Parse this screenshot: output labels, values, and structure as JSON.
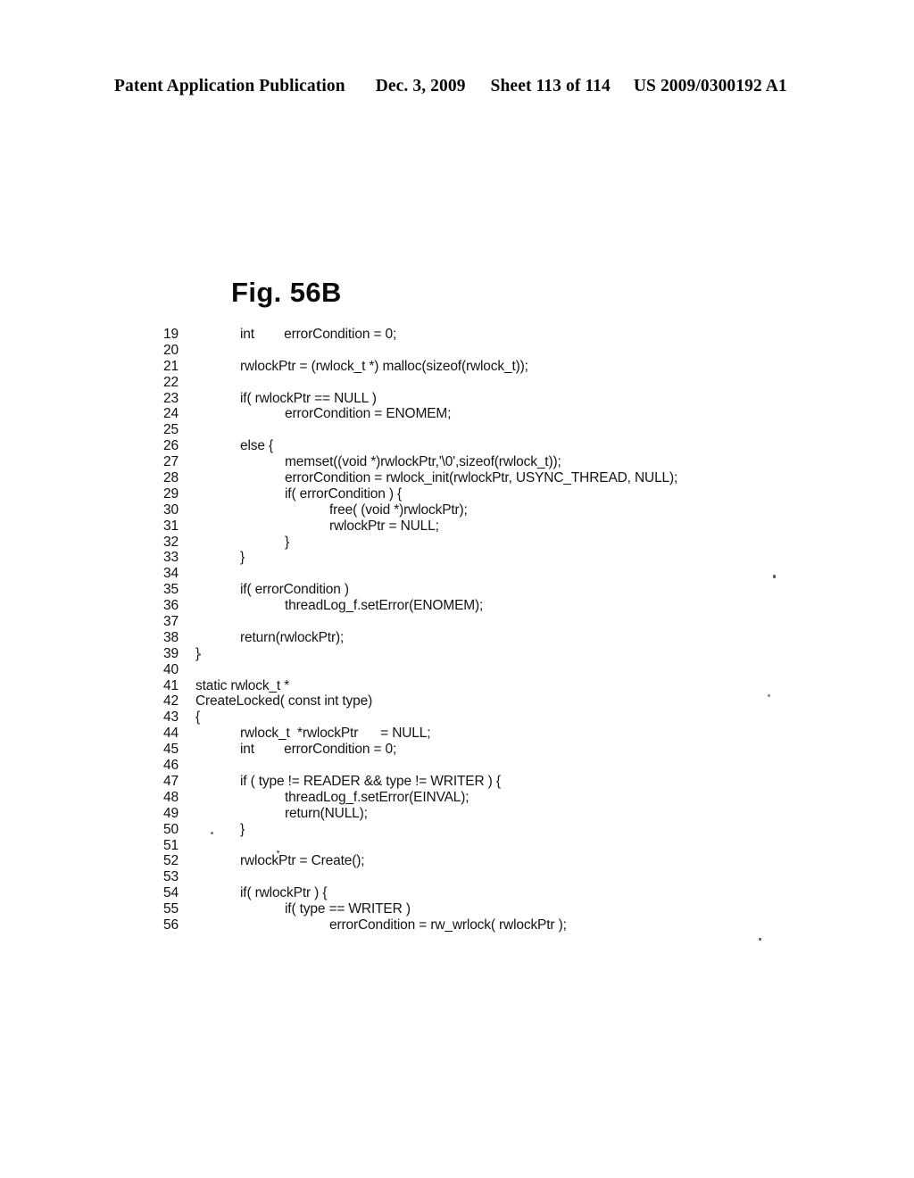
{
  "header": {
    "publication": "Patent Application Publication",
    "date": "Dec. 3, 2009",
    "sheet": "Sheet 113 of 114",
    "doc_number": "US 2009/0300192 A1"
  },
  "figure": {
    "label": "Fig. 56B"
  },
  "listing": {
    "lines": [
      {
        "no": "19",
        "indent": 1,
        "code": "int        errorCondition = 0;"
      },
      {
        "no": "20",
        "indent": 0,
        "code": ""
      },
      {
        "no": "21",
        "indent": 1,
        "code": "rwlockPtr = (rwlock_t *) malloc(sizeof(rwlock_t));"
      },
      {
        "no": "22",
        "indent": 0,
        "code": ""
      },
      {
        "no": "23",
        "indent": 1,
        "code": "if( rwlockPtr == NULL )"
      },
      {
        "no": "24",
        "indent": 2,
        "code": "errorCondition = ENOMEM;"
      },
      {
        "no": "25",
        "indent": 0,
        "code": ""
      },
      {
        "no": "26",
        "indent": 1,
        "code": "else {"
      },
      {
        "no": "27",
        "indent": 2,
        "code": "memset((void *)rwlockPtr,'\\0',sizeof(rwlock_t));"
      },
      {
        "no": "28",
        "indent": 2,
        "code": "errorCondition = rwlock_init(rwlockPtr, USYNC_THREAD, NULL);"
      },
      {
        "no": "29",
        "indent": 2,
        "code": "if( errorCondition ) {"
      },
      {
        "no": "30",
        "indent": 3,
        "code": "free( (void *)rwlockPtr);"
      },
      {
        "no": "31",
        "indent": 3,
        "code": "rwlockPtr = NULL;"
      },
      {
        "no": "32",
        "indent": 2,
        "code": "}"
      },
      {
        "no": "33",
        "indent": 1,
        "code": "}"
      },
      {
        "no": "34",
        "indent": 0,
        "code": ""
      },
      {
        "no": "35",
        "indent": 1,
        "code": "if( errorCondition )"
      },
      {
        "no": "36",
        "indent": 2,
        "code": "threadLog_f.setError(ENOMEM);"
      },
      {
        "no": "37",
        "indent": 0,
        "code": ""
      },
      {
        "no": "38",
        "indent": 1,
        "code": "return(rwlockPtr);"
      },
      {
        "no": "39",
        "indent": 0,
        "code": "}"
      },
      {
        "no": "40",
        "indent": 0,
        "code": ""
      },
      {
        "no": "41",
        "indent": 0,
        "code": "static rwlock_t *"
      },
      {
        "no": "42",
        "indent": 0,
        "code": "CreateLocked( const int type)"
      },
      {
        "no": "43",
        "indent": 0,
        "code": "{"
      },
      {
        "no": "44",
        "indent": 1,
        "code": "rwlock_t  *rwlockPtr      = NULL;"
      },
      {
        "no": "45",
        "indent": 1,
        "code": "int        errorCondition = 0;"
      },
      {
        "no": "46",
        "indent": 0,
        "code": ""
      },
      {
        "no": "47",
        "indent": 1,
        "code": "if ( type != READER && type != WRITER ) {"
      },
      {
        "no": "48",
        "indent": 2,
        "code": "threadLog_f.setError(EINVAL);"
      },
      {
        "no": "49",
        "indent": 2,
        "code": "return(NULL);"
      },
      {
        "no": "50",
        "indent": 1,
        "code": "}"
      },
      {
        "no": "51",
        "indent": 0,
        "code": ""
      },
      {
        "no": "52",
        "indent": 1,
        "code": "rwlockPtr = Create();"
      },
      {
        "no": "53",
        "indent": 0,
        "code": ""
      },
      {
        "no": "54",
        "indent": 1,
        "code": "if( rwlockPtr ) {"
      },
      {
        "no": "55",
        "indent": 2,
        "code": "if( type == WRITER )"
      },
      {
        "no": "56",
        "indent": 3,
        "code": "errorCondition = rw_wrlock( rwlockPtr );"
      }
    ]
  },
  "colors": {
    "page_background": "#ffffff",
    "text": "#101010",
    "speck": "#555555"
  }
}
